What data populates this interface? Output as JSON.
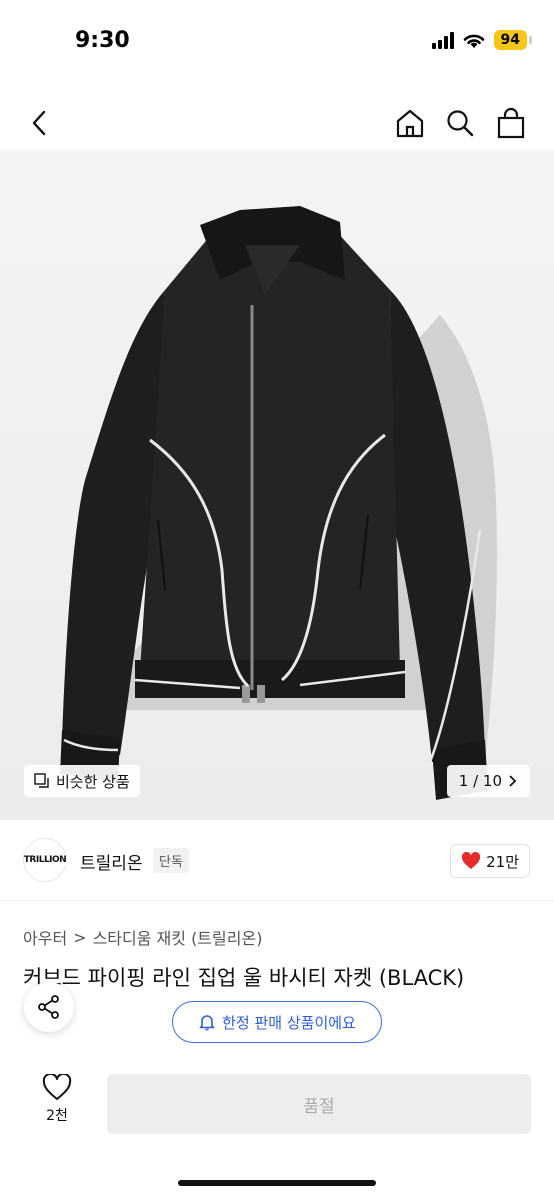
{
  "status_bar": {
    "time": "9:30",
    "battery": "94"
  },
  "nav": {
    "icons": [
      "chevron-left-icon",
      "home-icon",
      "search-icon",
      "shopping-bag-icon"
    ]
  },
  "gallery": {
    "similar_label": "비슷한 상품",
    "counter": "1 / 10"
  },
  "brand": {
    "logo_text": "TRILLION",
    "name": "트릴리온",
    "badge": "단독",
    "likes": "21만"
  },
  "breadcrumb": {
    "category": "아우터",
    "separator": ">",
    "subcategory": "스타디움 재킷 (트릴리온)"
  },
  "product": {
    "title": "커브드 파이핑 라인 집업 울 바시티 자켓 (BLACK)"
  },
  "limited_notice": "한정 판매 상품이에요",
  "bottom": {
    "wish_count": "2천",
    "buy_label": "품절"
  },
  "colors": {
    "accent_blue": "#2d5fd6",
    "heart_red": "#e52b2b",
    "battery_yellow": "#f5c518"
  }
}
